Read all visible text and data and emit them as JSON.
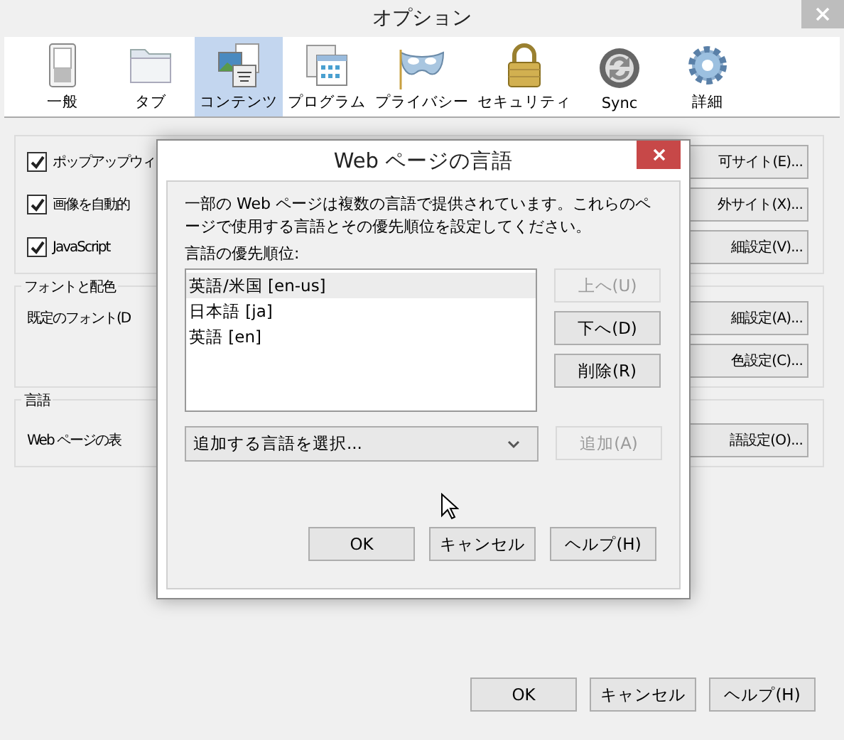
{
  "window": {
    "title": "オプション"
  },
  "toolbar": [
    {
      "label": "一般",
      "kind": "switch",
      "selected": false
    },
    {
      "label": "タブ",
      "kind": "folder",
      "selected": false
    },
    {
      "label": "コンテンツ",
      "kind": "content",
      "selected": true
    },
    {
      "label": "プログラム",
      "kind": "program",
      "selected": false
    },
    {
      "label": "プライバシー",
      "kind": "mask",
      "selected": false
    },
    {
      "label": "セキュリティ",
      "kind": "lock",
      "selected": false
    },
    {
      "label": "Sync",
      "kind": "sync",
      "selected": false
    },
    {
      "label": "詳細",
      "kind": "gear",
      "selected": false
    }
  ],
  "groups": [
    {
      "rows": [
        {
          "kind": "checkbox",
          "label": "ポップアップウィ",
          "checked": true,
          "button": "可サイト(E)..."
        },
        {
          "kind": "checkbox",
          "label": "画像を自動的",
          "checked": true,
          "button": "外サイト(X)..."
        },
        {
          "kind": "checkbox",
          "label": "JavaScript",
          "checked": true,
          "button": "細設定(V)..."
        }
      ]
    },
    {
      "title": "フォントと配色",
      "rows": [
        {
          "kind": "text",
          "label": "既定のフォント(D",
          "button": "細設定(A)..."
        },
        {
          "kind": "text",
          "button": "色設定(C)..."
        }
      ]
    },
    {
      "title": "言語",
      "rows": [
        {
          "kind": "text",
          "label": "Web ページの表",
          "button": "語設定(O)..."
        }
      ]
    }
  ],
  "buttons": [
    "OK",
    "キャンセル",
    "ヘルプ(H)"
  ],
  "dialog": {
    "title": "Web ページの言語",
    "description": "一部の Web ページは複数の言語で提供されています。これらのページで使用する言語とその優先順位を設定してください。",
    "list_label": "言語の優先順位:",
    "languages": [
      {
        "label": "英語/米国 [en-us]",
        "selected": true
      },
      {
        "label": "日本語 [ja]",
        "selected": false
      },
      {
        "label": "英語 [en]",
        "selected": false
      }
    ],
    "side_buttons": [
      {
        "label": "上へ(U)",
        "disabled": true
      },
      {
        "label": "下へ(D)",
        "disabled": false
      },
      {
        "label": "削除(R)",
        "disabled": false
      }
    ],
    "add_select": {
      "value": "追加する言語を選択..."
    },
    "add_button": {
      "label": "追加(A)",
      "disabled": true
    },
    "buttons": [
      "OK",
      "キャンセル",
      "ヘルプ(H)"
    ]
  }
}
